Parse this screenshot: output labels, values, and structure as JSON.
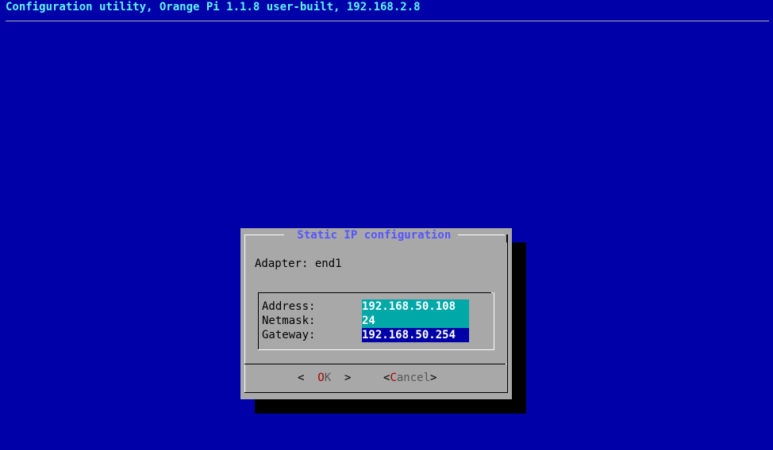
{
  "backtitle": "Configuration utility, Orange Pi 1.1.8 user-built, 192.168.2.8",
  "dialog": {
    "title": " Static IP configuration ",
    "adapter_text": "Adapter: end1",
    "fields": [
      {
        "label": "Address:",
        "value": "192.168.50.108",
        "state": "normal"
      },
      {
        "label": "Netmask:",
        "value": "24",
        "state": "normal"
      },
      {
        "label": "Gateway:",
        "value": "192.168.50.254",
        "state": "active"
      }
    ],
    "buttons": {
      "ok": {
        "left": "<  ",
        "hotkey": "O",
        "rest": "K",
        "right": "  >"
      },
      "cancel": {
        "left": "<",
        "hotkey": "C",
        "rest": "ancel",
        "right": ">"
      }
    }
  },
  "colors": {
    "background": "#0000a8",
    "backtitle": "#5ff5f5",
    "dialog": "#a8a8a8",
    "title": "#5555ff",
    "field": "#00a8a8",
    "field_active": "#0000a8",
    "hotkey": "#a80000"
  }
}
